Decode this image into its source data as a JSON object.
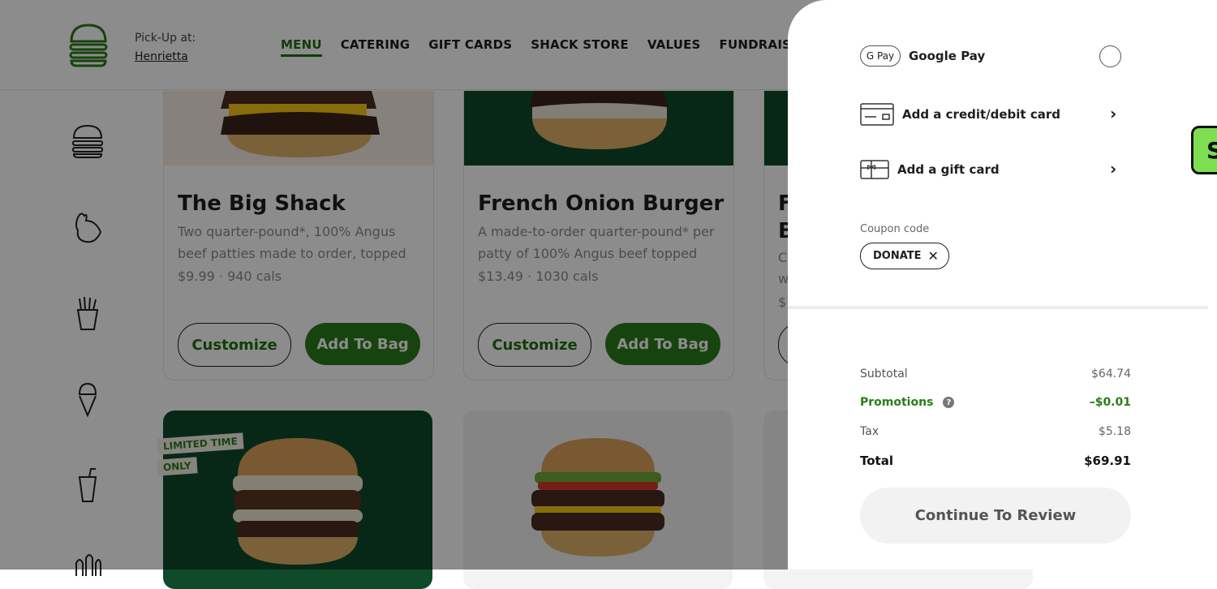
{
  "header": {
    "pickup_label": "Pick-Up at:",
    "pickup_location": "Henrietta",
    "nav": [
      "MENU",
      "CATERING",
      "GIFT CARDS",
      "SHACK STORE",
      "VALUES",
      "FUNDRAISING"
    ]
  },
  "menu_items": [
    {
      "name": "The Big Shack",
      "desc": "Two quarter-pound*, 100% Angus beef patties made to order, topped with...",
      "meta": "$9.99 · 940 cals",
      "customize": "Customize",
      "add": "Add To Bag"
    },
    {
      "name": "French Onion Burger",
      "desc": "A made-to-order quarter-pound* per patty of 100% Angus beef topped wit...",
      "meta": "$13.49 · 1030 cals",
      "customize": "Customize",
      "add": "Add To Bag"
    },
    {
      "name": "F",
      "name2": "B",
      "desc": "C",
      "desc2": "w",
      "meta": "$"
    }
  ],
  "badge": {
    "line1": "LIMITED TIME",
    "line2": "ONLY"
  },
  "panel": {
    "google_pay_label": "Google Pay",
    "gpay_chip": "G Pay",
    "add_card_label": "Add a credit/debit card",
    "add_gift_label": "Add a gift card",
    "coupon_label": "Coupon code",
    "coupon_code": "DONATE",
    "summary": {
      "subtotal_label": "Subtotal",
      "subtotal_value": "$64.74",
      "promo_label": "Promotions",
      "promo_value": "–$0.01",
      "tax_label": "Tax",
      "tax_value": "$5.18",
      "total_label": "Total",
      "total_value": "$69.91"
    },
    "continue_label": "Continue To Review"
  },
  "side_tab_letter": "S",
  "colors": {
    "brand_green": "#2a7d1a",
    "panel_bg": "#ffffff",
    "overlay": "rgba(0,0,0,0.45)"
  }
}
